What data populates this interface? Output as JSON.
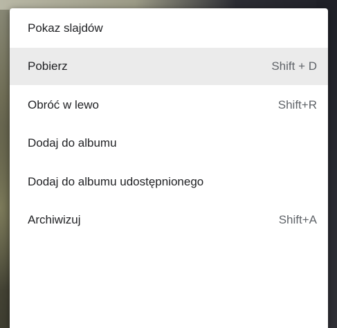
{
  "menu": {
    "items": [
      {
        "label": "Pokaz slajdów",
        "shortcut": ""
      },
      {
        "label": "Pobierz",
        "shortcut": "Shift + D"
      },
      {
        "label": "Obróć w lewo",
        "shortcut": "Shift+R"
      },
      {
        "label": "Dodaj do albumu",
        "shortcut": ""
      },
      {
        "label": "Dodaj do albumu udostępnionego",
        "shortcut": ""
      },
      {
        "label": "Archiwizuj",
        "shortcut": "Shift+A"
      }
    ],
    "highlighted_index": 1,
    "highlight_color": "#ebebeb",
    "text_color": "#202124",
    "shortcut_color": "#5f6368"
  }
}
